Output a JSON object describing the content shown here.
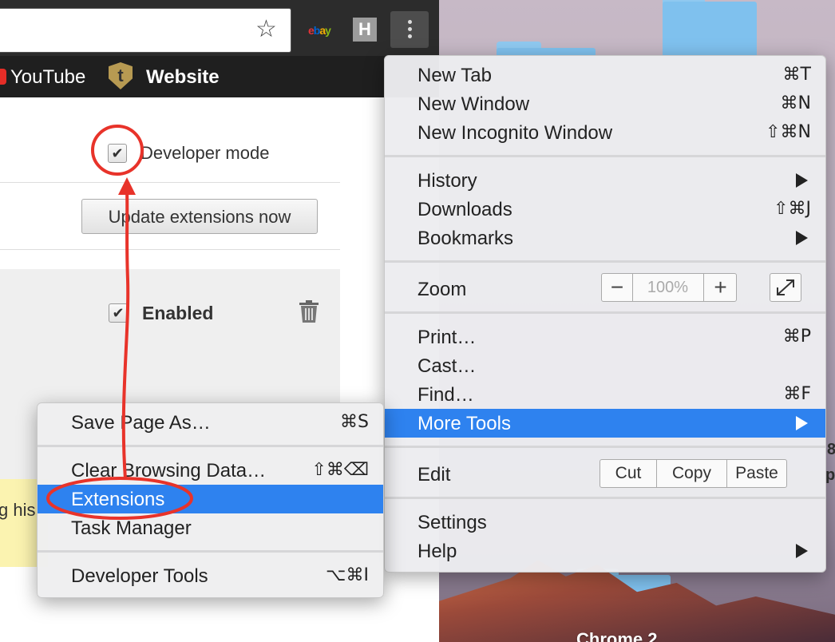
{
  "browser": {
    "bookmarks": [
      {
        "label": "YouTube"
      },
      {
        "label": "Website"
      }
    ],
    "toolbar": {
      "ebay_letters": [
        "e",
        "b",
        "a",
        "y"
      ],
      "h_icon_letter": "H"
    }
  },
  "extensions_page": {
    "developer_mode_label": "Developer mode",
    "developer_mode_checked": true,
    "update_button_label": "Update extensions now",
    "enabled_label": "Enabled",
    "enabled_checked": true,
    "history_snippet": "g his"
  },
  "main_menu": {
    "items": [
      {
        "label": "New Tab",
        "shortcut": "⌘T"
      },
      {
        "label": "New Window",
        "shortcut": "⌘N"
      },
      {
        "label": "New Incognito Window",
        "shortcut": "⇧⌘N"
      },
      {
        "label": "History",
        "submenu": true
      },
      {
        "label": "Downloads",
        "shortcut": "⇧⌘J"
      },
      {
        "label": "Bookmarks",
        "submenu": true
      },
      {
        "label": "Zoom"
      },
      {
        "label": "Print…",
        "shortcut": "⌘P"
      },
      {
        "label": "Cast…"
      },
      {
        "label": "Find…",
        "shortcut": "⌘F"
      },
      {
        "label": "More Tools",
        "submenu": true,
        "selected": true
      },
      {
        "label": "Edit"
      },
      {
        "label": "Settings"
      },
      {
        "label": "Help",
        "submenu": true
      }
    ],
    "zoom": {
      "minus": "−",
      "level": "100%",
      "plus": "+"
    },
    "edit": {
      "cut": "Cut",
      "copy": "Copy",
      "paste": "Paste"
    }
  },
  "more_tools_menu": {
    "items": [
      {
        "label": "Save Page As…",
        "shortcut": "⌘S"
      },
      {
        "label": "Clear Browsing Data…",
        "shortcut": "⇧⌘⌫"
      },
      {
        "label": "Extensions",
        "selected": true
      },
      {
        "label": "Task Manager"
      },
      {
        "label": "Developer Tools",
        "shortcut": "⌥⌘I"
      }
    ]
  },
  "desktop": {
    "partial_label": "Chrome 2",
    "edge_chars": [
      "8",
      "p"
    ],
    "left_char": "g"
  },
  "colors": {
    "selection": "#2e82ef",
    "annotation": "#e8332a"
  }
}
